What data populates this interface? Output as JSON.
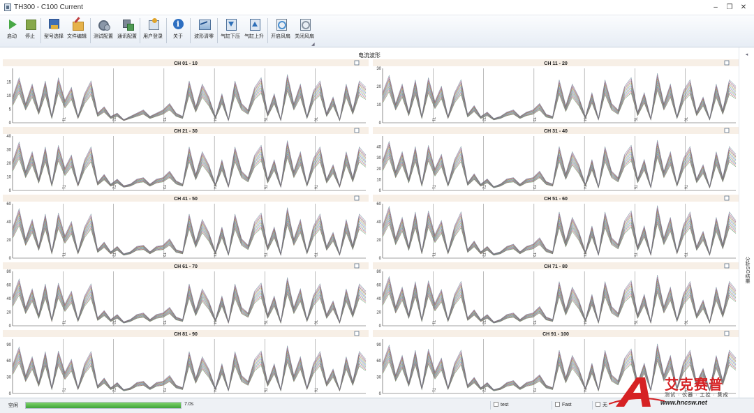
{
  "window": {
    "title": "TH300 - C100 Current",
    "minimize_glyph": "–",
    "restore_glyph": "❐",
    "close_glyph": "✕"
  },
  "toolbar": {
    "buttons": [
      {
        "id": "start",
        "label": "启动",
        "icon": "play-icon"
      },
      {
        "id": "stop",
        "label": "停止",
        "icon": "stop-icon"
      },
      {
        "id": "model",
        "label": "型号选择",
        "icon": "model-icon"
      },
      {
        "id": "file",
        "label": "文件编辑",
        "icon": "file-edit-icon"
      },
      {
        "id": "test-config",
        "label": "测试配置",
        "icon": "gear-icon"
      },
      {
        "id": "comm-config",
        "label": "通讯配置",
        "icon": "comm-icon"
      },
      {
        "id": "login",
        "label": "用户登录",
        "icon": "user-icon"
      },
      {
        "id": "about",
        "label": "关于",
        "icon": "info-icon"
      },
      {
        "id": "clear",
        "label": "波形清零",
        "icon": "waveform-icon"
      },
      {
        "id": "cyl-down",
        "label": "气缸下压",
        "icon": "cylinder-down-icon"
      },
      {
        "id": "cyl-up",
        "label": "气缸上升",
        "icon": "cylinder-up-icon"
      },
      {
        "id": "fan-on",
        "label": "开启风扇",
        "icon": "fan-on-icon"
      },
      {
        "id": "fan-off",
        "label": "关闭风扇",
        "icon": "fan-off-icon"
      }
    ],
    "corner_glyph": "◢"
  },
  "main": {
    "title": "电流波形",
    "pin_glyph": "◂",
    "side_tab": "分析SG结果"
  },
  "chart_data": [
    {
      "type": "line",
      "title": "CH 01 - 10",
      "ylim": [
        0,
        20
      ],
      "yticks": [
        0,
        5,
        10,
        15
      ],
      "segments": [
        "T1",
        "T2",
        "T3",
        "T4",
        "T5",
        "T6"
      ],
      "y": [
        8,
        14,
        6,
        12,
        4,
        13,
        2,
        14,
        7,
        11,
        2,
        9,
        13,
        3,
        5,
        2,
        3,
        1,
        2,
        3,
        4,
        2,
        3,
        4,
        6,
        3,
        2,
        13,
        5,
        12,
        8,
        2,
        9,
        1,
        13,
        6,
        4,
        11,
        14,
        3,
        9,
        1,
        15,
        6,
        12,
        2,
        10,
        13,
        3,
        8,
        1,
        12,
        4,
        13,
        11
      ],
      "series_count": 10
    },
    {
      "type": "line",
      "title": "CH 11 - 20",
      "ylim": [
        0,
        30
      ],
      "yticks": [
        0,
        10,
        20,
        30
      ],
      "segments": [
        "T1",
        "T2",
        "T3",
        "T4",
        "T5",
        "T6"
      ],
      "y": [
        14,
        22,
        9,
        18,
        5,
        20,
        3,
        21,
        10,
        17,
        3,
        14,
        20,
        4,
        8,
        3,
        5,
        2,
        3,
        5,
        6,
        3,
        5,
        6,
        9,
        4,
        3,
        20,
        8,
        18,
        12,
        3,
        14,
        2,
        20,
        9,
        6,
        17,
        21,
        5,
        14,
        2,
        23,
        9,
        18,
        3,
        15,
        20,
        5,
        12,
        2,
        18,
        6,
        20,
        17
      ],
      "series_count": 10
    },
    {
      "type": "line",
      "title": "CH 21 - 30",
      "ylim": [
        0,
        40
      ],
      "yticks": [
        0,
        10,
        20,
        30,
        40
      ],
      "segments": [
        "T1",
        "T2",
        "T3",
        "T4",
        "T5",
        "T6"
      ],
      "y": [
        18,
        30,
        12,
        24,
        7,
        27,
        4,
        28,
        14,
        22,
        4,
        19,
        27,
        5,
        10,
        4,
        7,
        3,
        4,
        7,
        8,
        4,
        7,
        8,
        12,
        6,
        4,
        27,
        10,
        24,
        16,
        4,
        19,
        3,
        27,
        12,
        8,
        22,
        28,
        7,
        19,
        3,
        31,
        12,
        24,
        4,
        20,
        27,
        7,
        16,
        3,
        24,
        8,
        27,
        22
      ],
      "series_count": 10
    },
    {
      "type": "line",
      "title": "CH 31 - 40",
      "ylim": [
        0,
        50
      ],
      "yticks": [
        0,
        10,
        20,
        30,
        40
      ],
      "segments": [
        "T1",
        "T2",
        "T3",
        "T4",
        "T5",
        "T6"
      ],
      "y": [
        23,
        38,
        15,
        30,
        9,
        34,
        5,
        35,
        17,
        28,
        5,
        24,
        34,
        6,
        13,
        5,
        9,
        3,
        5,
        9,
        10,
        5,
        9,
        10,
        15,
        7,
        5,
        34,
        13,
        30,
        20,
        5,
        24,
        3,
        34,
        15,
        10,
        28,
        35,
        9,
        24,
        3,
        39,
        15,
        30,
        5,
        25,
        34,
        9,
        20,
        3,
        30,
        10,
        34,
        28
      ],
      "series_count": 10
    },
    {
      "type": "line",
      "title": "CH 41 - 50",
      "ylim": [
        0,
        60
      ],
      "yticks": [
        0,
        20,
        40,
        60
      ],
      "segments": [
        "T1",
        "T2",
        "T3",
        "T4",
        "T5",
        "T6"
      ],
      "y": [
        28,
        46,
        18,
        36,
        11,
        41,
        6,
        42,
        21,
        34,
        6,
        29,
        41,
        8,
        15,
        6,
        11,
        4,
        6,
        11,
        12,
        6,
        11,
        12,
        18,
        8,
        6,
        41,
        15,
        36,
        24,
        6,
        29,
        4,
        41,
        18,
        12,
        34,
        42,
        11,
        29,
        4,
        47,
        18,
        36,
        6,
        30,
        41,
        11,
        24,
        4,
        36,
        12,
        41,
        34
      ],
      "series_count": 10
    },
    {
      "type": "line",
      "title": "CH 51 - 60",
      "ylim": [
        0,
        60
      ],
      "yticks": [
        0,
        20,
        40,
        60
      ],
      "segments": [
        "T1",
        "T2",
        "T3",
        "T4",
        "T5",
        "T6"
      ],
      "y": [
        30,
        48,
        19,
        38,
        11,
        43,
        6,
        44,
        22,
        35,
        6,
        30,
        43,
        8,
        16,
        6,
        11,
        4,
        6,
        11,
        13,
        6,
        11,
        13,
        19,
        9,
        6,
        43,
        16,
        38,
        25,
        6,
        30,
        4,
        43,
        19,
        13,
        35,
        44,
        11,
        30,
        4,
        49,
        19,
        38,
        6,
        31,
        43,
        11,
        25,
        4,
        38,
        13,
        43,
        35
      ],
      "series_count": 10
    },
    {
      "type": "line",
      "title": "CH 61 - 70",
      "ylim": [
        0,
        80
      ],
      "yticks": [
        0,
        20,
        40,
        60,
        80
      ],
      "segments": [
        "T1",
        "T2",
        "T3",
        "T4",
        "T5",
        "T6"
      ],
      "y": [
        36,
        58,
        23,
        46,
        14,
        52,
        8,
        53,
        27,
        43,
        8,
        37,
        52,
        10,
        19,
        8,
        14,
        5,
        8,
        14,
        16,
        8,
        14,
        16,
        23,
        11,
        8,
        52,
        19,
        46,
        31,
        8,
        37,
        5,
        52,
        23,
        16,
        43,
        53,
        14,
        37,
        5,
        60,
        23,
        46,
        8,
        38,
        52,
        14,
        31,
        5,
        46,
        16,
        52,
        43
      ],
      "series_count": 10
    },
    {
      "type": "line",
      "title": "CH 71 - 80",
      "ylim": [
        0,
        80
      ],
      "yticks": [
        0,
        20,
        40,
        60,
        80
      ],
      "segments": [
        "T1",
        "T2",
        "T3",
        "T4",
        "T5",
        "T6"
      ],
      "y": [
        38,
        61,
        24,
        48,
        14,
        55,
        8,
        56,
        28,
        45,
        8,
        39,
        55,
        10,
        20,
        8,
        14,
        5,
        8,
        14,
        16,
        8,
        14,
        16,
        24,
        11,
        8,
        55,
        20,
        48,
        32,
        8,
        39,
        5,
        55,
        24,
        16,
        45,
        56,
        14,
        39,
        5,
        63,
        24,
        48,
        8,
        40,
        55,
        14,
        32,
        5,
        48,
        16,
        55,
        45
      ],
      "series_count": 10
    },
    {
      "type": "line",
      "title": "CH 81 - 90",
      "ylim": [
        0,
        100
      ],
      "yticks": [
        0,
        30,
        60,
        90
      ],
      "segments": [
        "T1",
        "T2",
        "T3",
        "T4",
        "T5",
        "T6"
      ],
      "y": [
        44,
        72,
        28,
        57,
        17,
        65,
        9,
        66,
        33,
        53,
        9,
        46,
        65,
        12,
        24,
        9,
        17,
        6,
        9,
        17,
        19,
        9,
        17,
        19,
        28,
        13,
        9,
        65,
        24,
        57,
        38,
        9,
        46,
        6,
        65,
        28,
        19,
        53,
        66,
        17,
        46,
        6,
        74,
        28,
        57,
        9,
        47,
        65,
        17,
        38,
        6,
        57,
        19,
        65,
        53
      ],
      "series_count": 10
    },
    {
      "type": "line",
      "title": "CH 91 - 100",
      "ylim": [
        0,
        100
      ],
      "yticks": [
        0,
        30,
        60,
        90
      ],
      "segments": [
        "T1",
        "T2",
        "T3",
        "T4",
        "T5",
        "T6"
      ],
      "y": [
        46,
        75,
        29,
        59,
        17,
        67,
        9,
        69,
        34,
        55,
        9,
        47,
        67,
        13,
        25,
        9,
        17,
        6,
        9,
        17,
        20,
        9,
        17,
        20,
        29,
        13,
        9,
        67,
        25,
        59,
        39,
        9,
        47,
        6,
        67,
        29,
        20,
        55,
        69,
        17,
        47,
        6,
        77,
        29,
        59,
        9,
        49,
        67,
        17,
        39,
        6,
        59,
        20,
        67,
        55
      ],
      "series_count": 10
    }
  ],
  "series_colors": [
    "#4e8f5a",
    "#c05050",
    "#4a74b8",
    "#7a9a3a",
    "#8a5aa8",
    "#3a9aa8",
    "#b8843a",
    "#5a5a5a",
    "#a84a78",
    "#6a8a9a"
  ],
  "statusbar": {
    "state": "空闲",
    "progress_percent": 100,
    "elapsed": "7.0s",
    "field1": "test",
    "field2": "Fast",
    "field3": "无"
  },
  "watermark": {
    "brand": "艾克赛普",
    "slogan": "测试 · 仪器 · 工控 · 集成",
    "url": "www.hncsw.net"
  }
}
